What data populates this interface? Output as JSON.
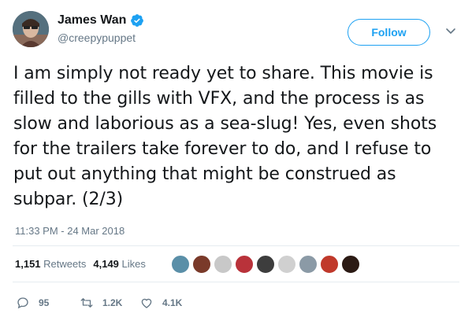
{
  "user": {
    "display_name": "James Wan",
    "handle": "@creepypuppet",
    "verified": true
  },
  "follow_button": {
    "label": "Follow"
  },
  "tweet": {
    "text": "I am simply not ready yet to share. This movie is filled to the gills with VFX, and the process is as slow and laborious as a sea-slug! Yes, even shots for the trailers take forever to do, and I refuse to put out anything that might be construed as subpar. (2/3)",
    "timestamp": "11:33 PM - 24 Mar 2018"
  },
  "stats": {
    "retweets_count": "1,151",
    "retweets_label": "Retweets",
    "likes_count": "4,149",
    "likes_label": "Likes"
  },
  "likers": [
    "#5a8fa8",
    "#7a3a2a",
    "#c8c8c8",
    "#b9323a",
    "#3d3d3d",
    "#d0d0d0",
    "#8b9aa6",
    "#c0392b",
    "#2b1a14"
  ],
  "actions": {
    "reply_count": "95",
    "retweet_count": "1.2K",
    "like_count": "4.1K"
  },
  "colors": {
    "accent": "#1da1f2",
    "secondary_text": "#657786",
    "primary_text": "#14171a"
  },
  "icons": [
    "verified-badge-icon",
    "chevron-down-icon",
    "reply-icon",
    "retweet-icon",
    "heart-icon"
  ]
}
